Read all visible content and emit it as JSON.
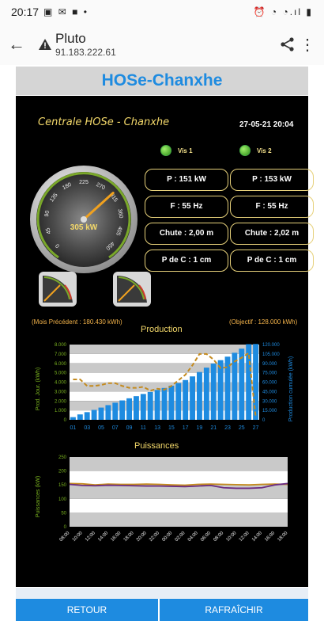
{
  "statusbar": {
    "time": "20:17",
    "left_icons": "▣ ✉ ■ •",
    "right_icons": "⏰ ◔ ◔.ıl ▮"
  },
  "browser": {
    "title": "Pluto",
    "address": "91.183.222.61",
    "back_icon": "arrow-left-icon",
    "warning_icon": "warning-icon",
    "share_icon": "share-icon",
    "more_icon": "more-vertical-icon"
  },
  "page": {
    "header": "HOSe-Chanxhe"
  },
  "dashboard": {
    "centrale_label": "Centrale HOSe - Chanxhe",
    "datetime": "27-05-21 20:04",
    "vis1_label": "Vis 1",
    "vis2_label": "Vis 2",
    "gauge": {
      "value_label": "305 kW",
      "value": 305,
      "min": 0,
      "max": 450,
      "ticks": [
        "0",
        "45",
        "90",
        "135",
        "180",
        "225",
        "270",
        "315",
        "360",
        "405",
        "450"
      ]
    },
    "vis1": {
      "p": "P : 151 kW",
      "f": "F : 55 Hz",
      "chute": "Chute : 2,00 m",
      "pdc": "P de C : 1 cm"
    },
    "vis2": {
      "p": "P : 153 kW",
      "f": "F : 55 Hz",
      "chute": "Chute : 2,02 m",
      "pdc": "P de C : 1 cm"
    },
    "prev_month": "(Mois Précédent : 180.430 kWh)",
    "objective": "(Objectif : 128.000 kWh)",
    "colors": {
      "bar": "#1e8be0",
      "line": "#c48a1e",
      "accent": "#f3d86a"
    }
  },
  "chart_data": [
    {
      "type": "bar",
      "title": "Production",
      "ylabel": "Prod. Jour. (kWh)",
      "y2label": "Production cumulée (kWh)",
      "categories": [
        "01",
        "02",
        "03",
        "04",
        "05",
        "06",
        "07",
        "08",
        "09",
        "10",
        "11",
        "12",
        "13",
        "14",
        "15",
        "16",
        "17",
        "18",
        "19",
        "20",
        "21",
        "22",
        "23",
        "24",
        "25",
        "26",
        "27"
      ],
      "x_tick_labels": [
        "01",
        "03",
        "05",
        "07",
        "09",
        "11",
        "13",
        "15",
        "17",
        "19",
        "21",
        "23",
        "25",
        "27"
      ],
      "ylim": [
        0,
        8000
      ],
      "y_ticks": [
        "0",
        "1.000",
        "2.000",
        "3.000",
        "4.000",
        "5.000",
        "6.000",
        "7.000",
        "8.000"
      ],
      "y2lim": [
        0,
        120000
      ],
      "y2_ticks": [
        "0",
        "15.000",
        "30.000",
        "45.000",
        "60.000",
        "75.000",
        "90.000",
        "105.000",
        "120.000"
      ],
      "series": [
        {
          "name": "Prod. Jour. (kWh)",
          "kind": "line",
          "values": [
            4300,
            4300,
            3600,
            3600,
            3700,
            3900,
            3900,
            3600,
            3400,
            3400,
            3500,
            3100,
            3300,
            3200,
            3600,
            4200,
            4800,
            5800,
            7000,
            7000,
            6400,
            5500,
            5600,
            6200,
            6600,
            7100,
            300
          ]
        },
        {
          "name": "Production cumulée (kWh)",
          "kind": "bar",
          "values": [
            4300,
            8600,
            12200,
            15800,
            19500,
            23400,
            27300,
            30900,
            34300,
            37700,
            41200,
            44300,
            47600,
            50800,
            54400,
            58600,
            63400,
            69200,
            76200,
            83200,
            89600,
            95100,
            100700,
            106900,
            113500,
            120600,
            120900
          ]
        }
      ]
    },
    {
      "type": "line",
      "title": "Puissances",
      "ylabel": "Puissances (kW)",
      "ylim": [
        0,
        250
      ],
      "y_ticks": [
        "0",
        "50",
        "100",
        "150",
        "200",
        "250"
      ],
      "x_tick_labels": [
        "08:00",
        "10:00",
        "12:00",
        "14:00",
        "16:00",
        "18:00",
        "20:00",
        "22:00",
        "00:00",
        "02:00",
        "04:00",
        "06:00",
        "08:00",
        "10:00",
        "12:00",
        "14:00",
        "16:00",
        "18:00"
      ],
      "series": [
        {
          "name": "Vis 1",
          "color": "#c48a1e",
          "values": [
            155,
            154,
            150,
            153,
            152,
            152,
            153,
            152,
            150,
            149,
            152,
            153,
            152,
            151,
            150,
            152,
            153,
            152
          ]
        },
        {
          "name": "Vis 2",
          "color": "#6b2c82",
          "values": [
            152,
            148,
            147,
            149,
            148,
            147,
            146,
            146,
            145,
            144,
            146,
            148,
            140,
            138,
            138,
            140,
            150,
            155
          ]
        }
      ]
    }
  ],
  "buttons": {
    "back": "RETOUR",
    "refresh": "RAFRAÎCHIR"
  }
}
